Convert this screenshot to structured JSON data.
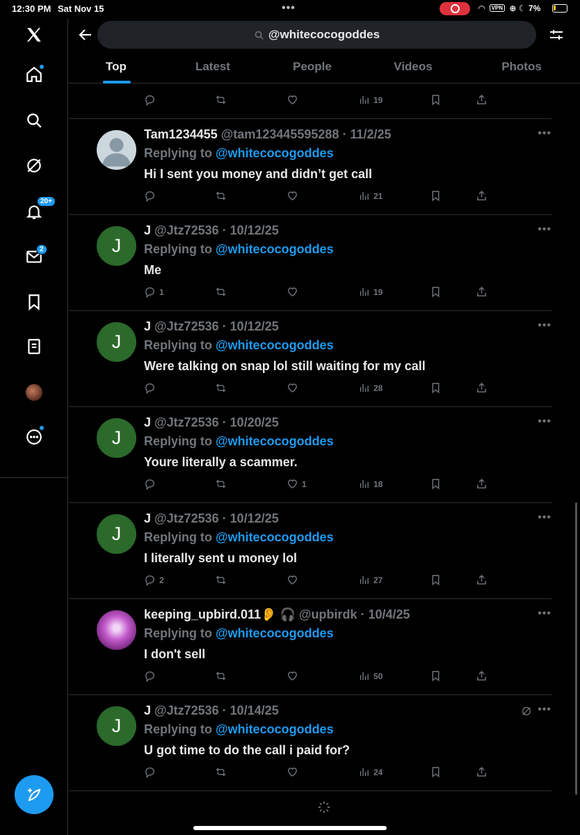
{
  "status": {
    "time": "12:30 PM",
    "date": "Sat Nov 15",
    "vpn": "VPN",
    "battery": "7%"
  },
  "search": {
    "query": "@whitecocogoddes"
  },
  "tabs": [
    {
      "label": "Top",
      "active": true
    },
    {
      "label": "Latest"
    },
    {
      "label": "People"
    },
    {
      "label": "Videos"
    },
    {
      "label": "Photos"
    }
  ],
  "sidebar": {
    "notifications_badge": "20+",
    "messages_badge": "2"
  },
  "first_tweet": {
    "views": "19"
  },
  "tweets": [
    {
      "avatar": "default",
      "name": "Tam1234455",
      "handle": "@tam123445595288",
      "date": "· 11/2/25",
      "replying_label": "Replying to",
      "replying_to": "@whitecocogoddes",
      "text": "Hi I sent you money and didn’t get call",
      "replies": "",
      "likes": "",
      "views": "21"
    },
    {
      "avatar": "J",
      "name": "J",
      "handle": "@Jtz72536",
      "date": "· 10/12/25",
      "replying_label": "Replying to",
      "replying_to": "@whitecocogoddes",
      "text": "Me",
      "replies": "1",
      "likes": "",
      "views": "19"
    },
    {
      "avatar": "J",
      "name": "J",
      "handle": "@Jtz72536",
      "date": "· 10/12/25",
      "replying_label": "Replying to",
      "replying_to": "@whitecocogoddes",
      "text": "Were talking on snap lol still waiting for my call",
      "replies": "",
      "likes": "",
      "views": "28"
    },
    {
      "avatar": "J",
      "name": "J",
      "handle": "@Jtz72536",
      "date": "· 10/20/25",
      "replying_label": "Replying to",
      "replying_to": "@whitecocogoddes",
      "text": "Youre literally a scammer.",
      "replies": "",
      "likes": "1",
      "views": "18"
    },
    {
      "avatar": "J",
      "name": "J",
      "handle": "@Jtz72536",
      "date": "· 10/12/25",
      "replying_label": "Replying to",
      "replying_to": "@whitecocogoddes",
      "text": "I literally sent u money lol",
      "replies": "2",
      "likes": "",
      "views": "27"
    },
    {
      "avatar": "pink",
      "name": "keeping_upbird.011👂 🎧",
      "handle": "@upbirdk",
      "date": "· 10/4/25",
      "replying_label": "Replying to",
      "replying_to": "@whitecocogoddes",
      "text": "I don't sell",
      "replies": "",
      "likes": "",
      "views": "50"
    },
    {
      "avatar": "J",
      "name": "J",
      "handle": "@Jtz72536",
      "date": "· 10/14/25",
      "replying_label": "Replying to",
      "replying_to": "@whitecocogoddes",
      "text": "U got time to do the call i paid for?",
      "replies": "",
      "likes": "",
      "views": "24",
      "grok": true
    }
  ],
  "colors": {
    "accent": "#1d9bf0",
    "muted": "#71767b",
    "background": "#000000",
    "avatar_green": "#2b6a2b"
  }
}
